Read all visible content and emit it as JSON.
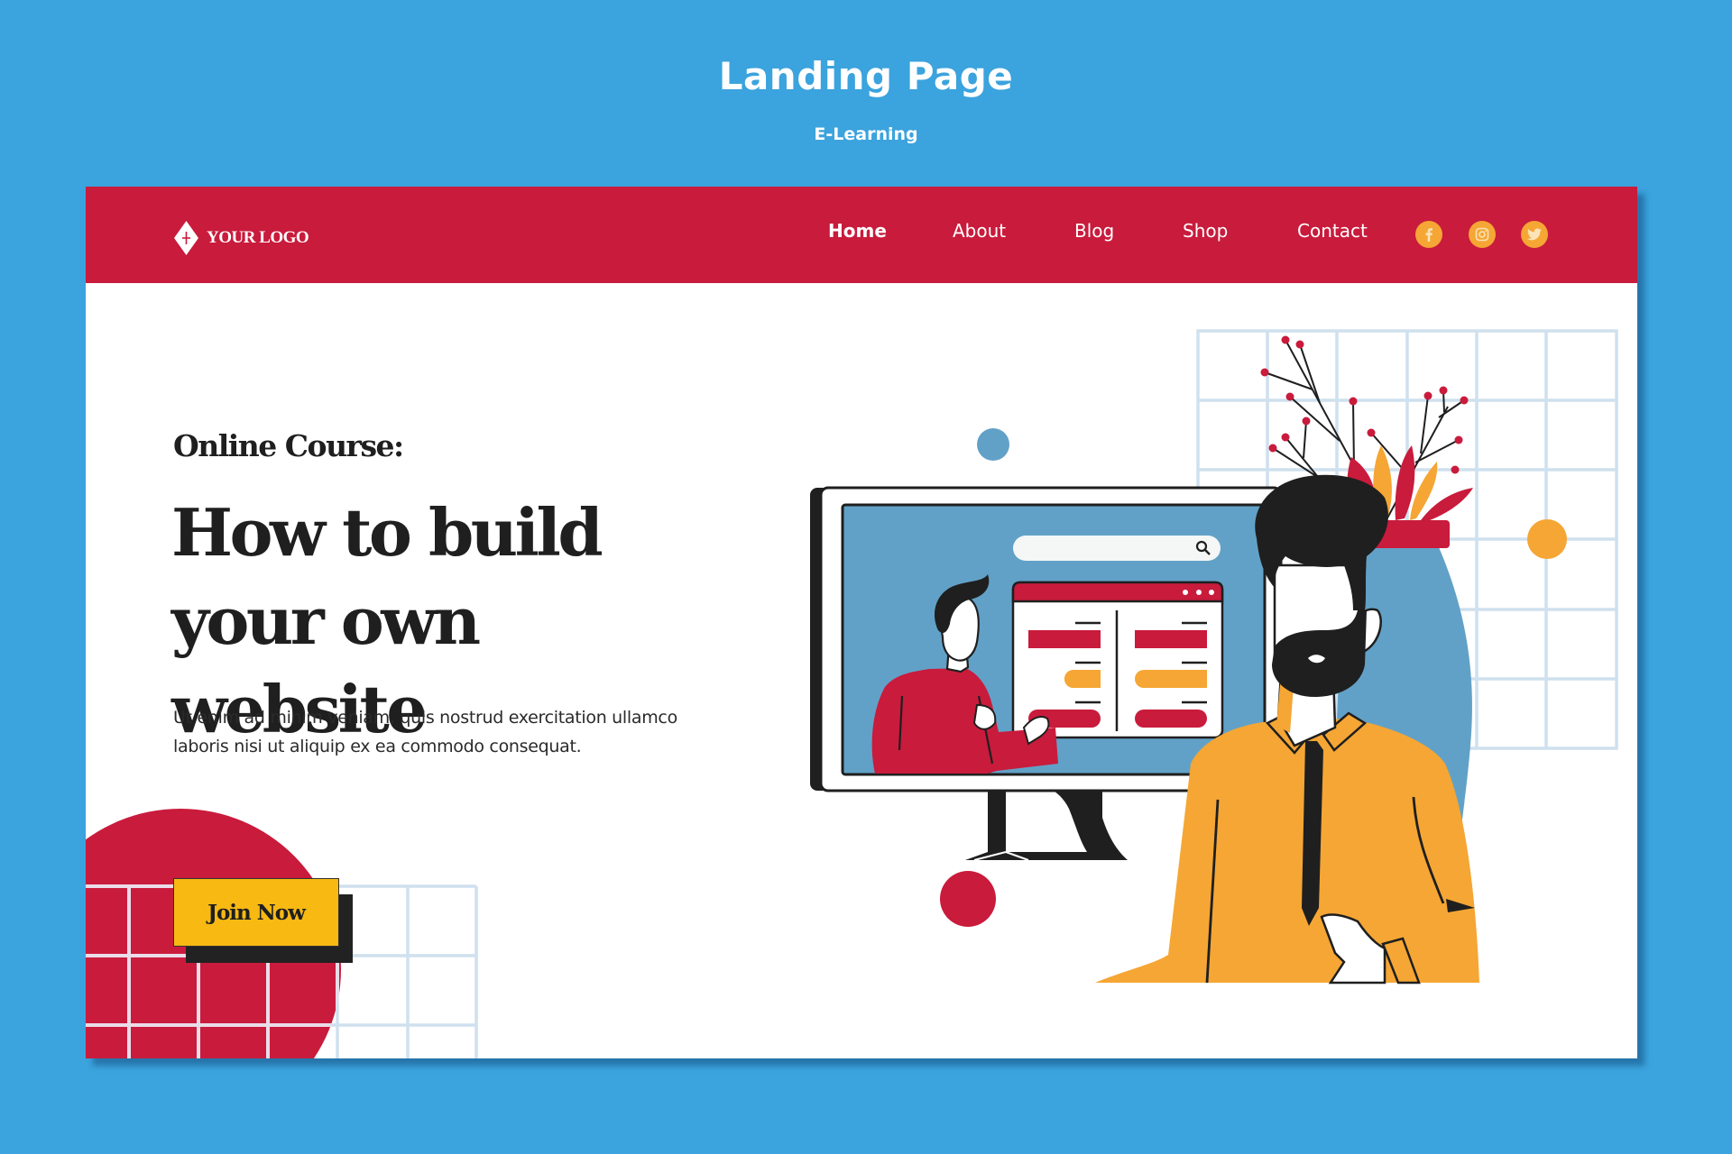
{
  "showcase": {
    "title": "Landing Page",
    "subtitle": "E-Learning"
  },
  "navbar": {
    "logo_text": "YOUR LOGO",
    "items": [
      {
        "label": "Home",
        "active": true
      },
      {
        "label": "About",
        "active": false
      },
      {
        "label": "Blog",
        "active": false
      },
      {
        "label": "Shop",
        "active": false
      },
      {
        "label": "Contact",
        "active": false
      }
    ],
    "social": [
      {
        "name": "facebook-icon",
        "glyph": "f"
      },
      {
        "name": "instagram-icon",
        "glyph": "instagram"
      },
      {
        "name": "twitter-icon",
        "glyph": "bird"
      }
    ]
  },
  "hero": {
    "kicker": "Online Course:",
    "title": "How to build your own website",
    "description": "Ut enim ad minim veniam, quis nostrud exercitation ullamco laboris nisi ut aliquip ex ea commodo consequat.",
    "cta_label": "Join Now"
  },
  "colors": {
    "background": "#3BA3DD",
    "brand_red": "#C91B3C",
    "accent_orange": "#F5A634",
    "button_yellow": "#F7B912",
    "screen_blue": "#62A1C7",
    "grid_line": "#CFE0EE",
    "ink": "#1F1F1F"
  }
}
